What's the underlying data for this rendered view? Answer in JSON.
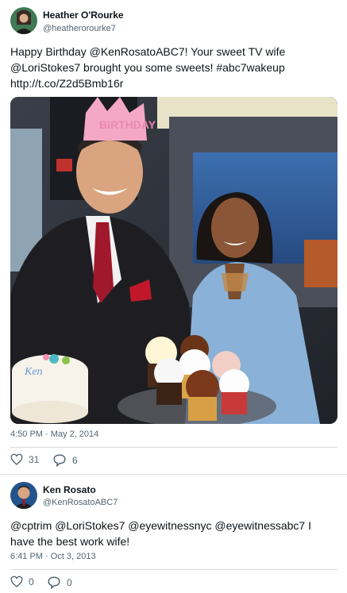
{
  "tweets": [
    {
      "author_name": "Heather O'Rourke",
      "author_handle": "@heatherorourke7",
      "text": "Happy Birthday @KenRosatoABC7! Your sweet TV wife @LoriStokes7 brought you some sweets! #abc7wakeup http://t.co/Z2d5Bmb16r",
      "time": "4:50 PM · May 2, 2014",
      "likes": "31",
      "replies": "6",
      "media_alt": "photo of anchors with birthday cake and cupcakes",
      "crown_text": "BIRTHDAY"
    },
    {
      "author_name": "Ken Rosato",
      "author_handle": "@KenRosatoABC7",
      "text": "@cptrim @LoriStokes7 @eyewitnessnyc @eyewitnessabc7 I have the best work wife!",
      "time": "6:41 PM · Oct 3, 2013",
      "likes": "0",
      "replies": "0"
    }
  ],
  "icons": {
    "like": "heart-icon",
    "reply": "reply-bubble-icon"
  },
  "colors": {
    "text": "#0f1419",
    "secondary": "#536471",
    "divider": "#d8dde2"
  }
}
